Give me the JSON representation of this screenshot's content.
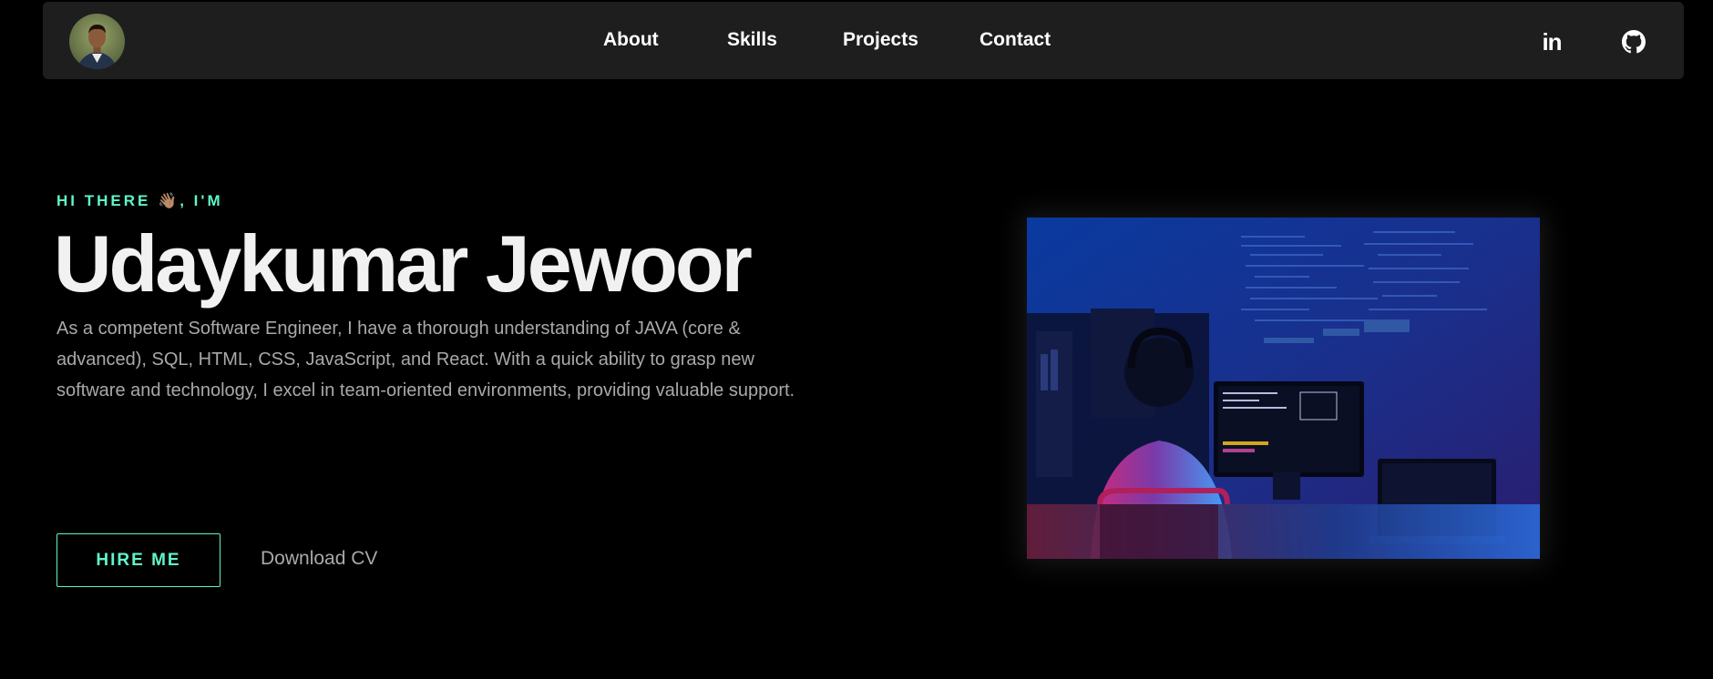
{
  "nav": {
    "links": [
      {
        "label": "About"
      },
      {
        "label": "Skills"
      },
      {
        "label": "Projects"
      },
      {
        "label": "Contact"
      }
    ],
    "social": [
      {
        "icon": "linkedin-icon"
      },
      {
        "icon": "github-icon"
      }
    ],
    "avatar_icon": "avatar"
  },
  "hero": {
    "greeting": "HI THERE 👋🏽, I'M",
    "name": "Udaykumar Jewoor",
    "bio": "As a competent Software Engineer, I have a thorough understanding of JAVA (core & advanced), SQL, HTML, CSS, JavaScript, and React. With a quick ability to grasp new software and technology, I excel in team-oriented environments, providing valuable support.",
    "hire_label": "HIRE ME",
    "cv_label": "Download CV"
  },
  "colors": {
    "background": "#000000",
    "navbar": "#1e1e1e",
    "accent": "#5ff5c8",
    "heading": "#f1f1f1",
    "muted": "#a9a9a9"
  }
}
